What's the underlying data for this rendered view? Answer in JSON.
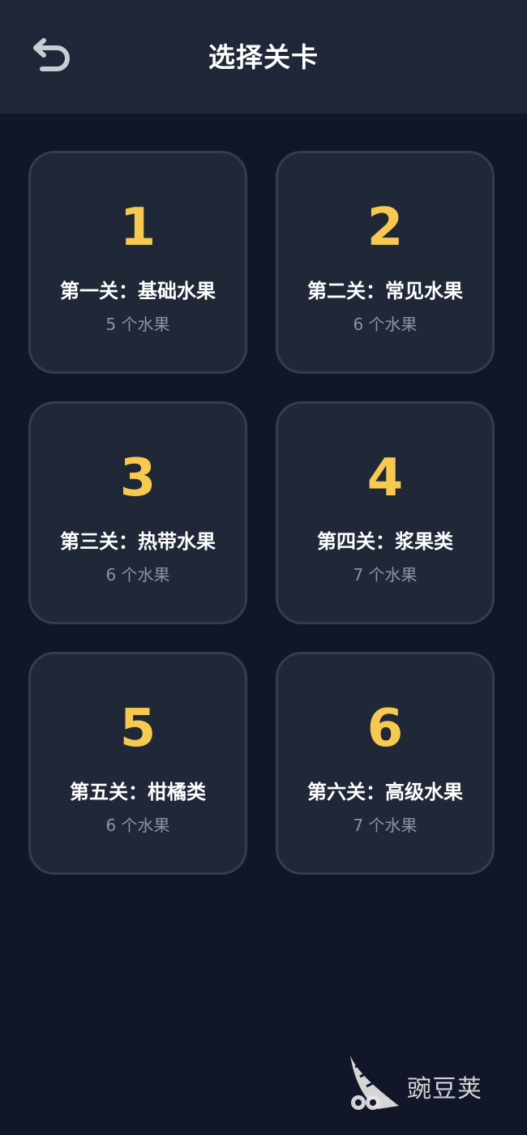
{
  "header": {
    "title": "选择关卡",
    "back_icon": "undo-arrow-icon"
  },
  "levels": [
    {
      "number": "1",
      "name": "第一关：基础水果",
      "count": "5 个水果"
    },
    {
      "number": "2",
      "name": "第二关：常见水果",
      "count": "6 个水果"
    },
    {
      "number": "3",
      "name": "第三关：热带水果",
      "count": "6 个水果"
    },
    {
      "number": "4",
      "name": "第四关：浆果类",
      "count": "7 个水果"
    },
    {
      "number": "5",
      "name": "第五关：柑橘类",
      "count": "6 个水果"
    },
    {
      "number": "6",
      "name": "第六关：高级水果",
      "count": "7 个水果"
    }
  ],
  "watermark": {
    "text": "豌豆荚",
    "icon": "wandoujia-logo-icon"
  },
  "colors": {
    "background": "#111729",
    "header": "#1f2738",
    "card": "#202838",
    "card_border": "#333d52",
    "accent": "#f7c950",
    "secondary_text": "#8c94a3"
  }
}
